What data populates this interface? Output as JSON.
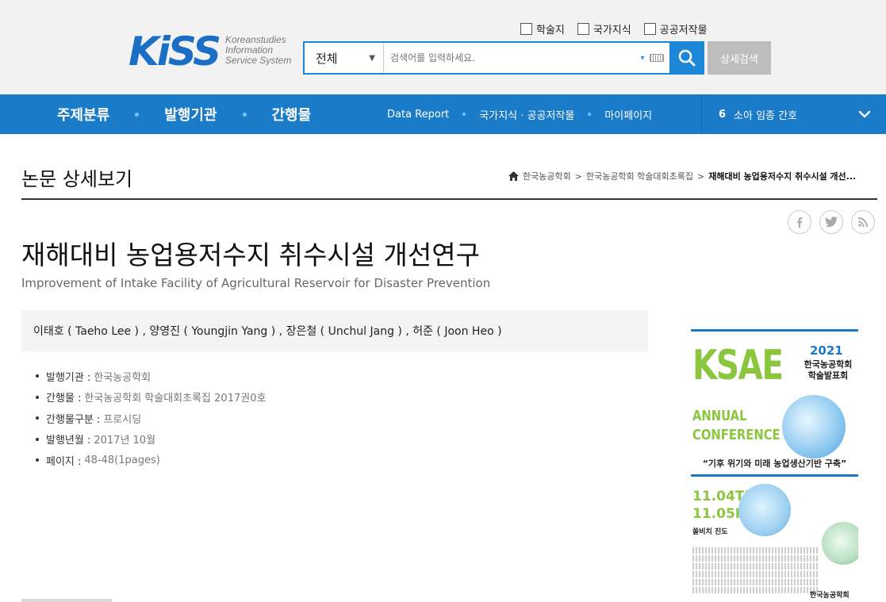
{
  "header": {
    "logo_mark": "KiSS",
    "logo_tagline": [
      "Koreanstudies",
      "Information",
      "Service System"
    ],
    "filters": [
      "학술지",
      "국가지식",
      "공공저작물"
    ],
    "search": {
      "scope": "전체",
      "placeholder": "검색어를 입력하세요."
    },
    "advanced_search_label": "상세검색"
  },
  "nav": {
    "main": [
      "주제분류",
      "발행기관",
      "간행물"
    ],
    "sub": [
      "Data Report",
      "국가지식 · 공공저작물",
      "마이페이지"
    ],
    "trending_rank": "6",
    "trending_term": "소아 임종 간호"
  },
  "page": {
    "title": "논문 상세보기",
    "breadcrumb": [
      "한국농공학회",
      "한국농공학회 학술대회초록집",
      "재해대비 농업용저수지 취수시설 개선..."
    ]
  },
  "article": {
    "title_ko": "재해대비 농업용저수지 취수시설 개선연구",
    "title_en": "Improvement of Intake Facility of Agricultural Reservoir for Disaster Prevention",
    "authors": "이태호 ( Taeho Lee ) , 양영진 ( Youngjin Yang ) , 장은철 ( Unchul Jang ) , 허준 ( Joon Heo )",
    "meta": [
      {
        "label": "발행기관 :",
        "value": "한국농공학회"
      },
      {
        "label": "간행물 :",
        "value": "한국농공학회 학술대회초록집 2017권0호"
      },
      {
        "label": "간행물구분 :",
        "value": "프로시딩"
      },
      {
        "label": "발행년월 :",
        "value": "2017년 10월"
      },
      {
        "label": "페이지 :",
        "value": "48-48(1pages)"
      }
    ]
  },
  "poster": {
    "logo": "KSAE",
    "year": "2021",
    "event_name": "한국농공학회 학술발표회",
    "annual": "ANNUAL",
    "conference": "CONFERENCE",
    "slogan": "“기후 위기와 미래 농업생산기반 구축”",
    "date1": "11.04THU",
    "date2": "11.05FRI",
    "venue": "쏠비치 진도",
    "organizer": "한국농공학회"
  },
  "colors": {
    "primary": "#1a7bc9",
    "search_border": "#1e88d8",
    "poster_green": "#8cc63f"
  },
  "icons": [
    "home-icon",
    "facebook-icon",
    "twitter-icon",
    "rss-icon",
    "search-icon",
    "keyboard-icon",
    "chevron-down-icon"
  ]
}
